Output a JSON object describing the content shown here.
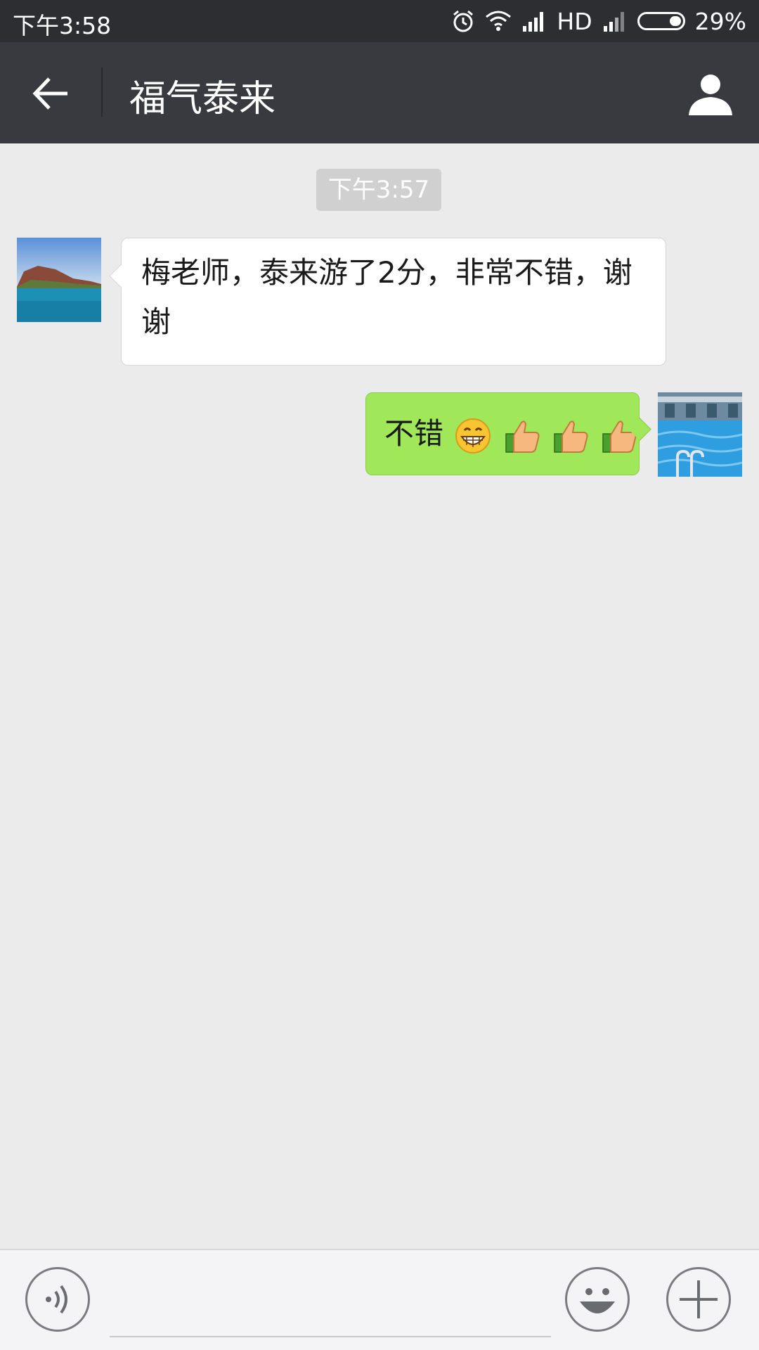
{
  "status_bar": {
    "time": "下午3:58",
    "network_label": "HD",
    "battery": "29%",
    "battery_level": 0.29
  },
  "header": {
    "title": "福气泰来"
  },
  "chat": {
    "timestamp": "下午3:57",
    "messages": [
      {
        "direction": "incoming",
        "text": "梅老师，泰来游了2分，非常不错，谢谢"
      },
      {
        "direction": "outgoing",
        "text": "不错"
      }
    ]
  },
  "input": {
    "placeholder": "",
    "value": ""
  },
  "colors": {
    "status_bar_bg": "#2d2e32",
    "title_bar_bg": "#393a3f",
    "chat_bg": "#ebebeb",
    "outgoing_bubble": "#a0e75a",
    "incoming_bubble": "#ffffff"
  },
  "icons": [
    "alarm-icon",
    "wifi-icon",
    "signal-icon",
    "battery-icon",
    "back-arrow-icon",
    "profile-icon",
    "grin-emoji-icon",
    "thumbs-up-icon",
    "voice-icon",
    "smiley-icon",
    "plus-icon"
  ]
}
